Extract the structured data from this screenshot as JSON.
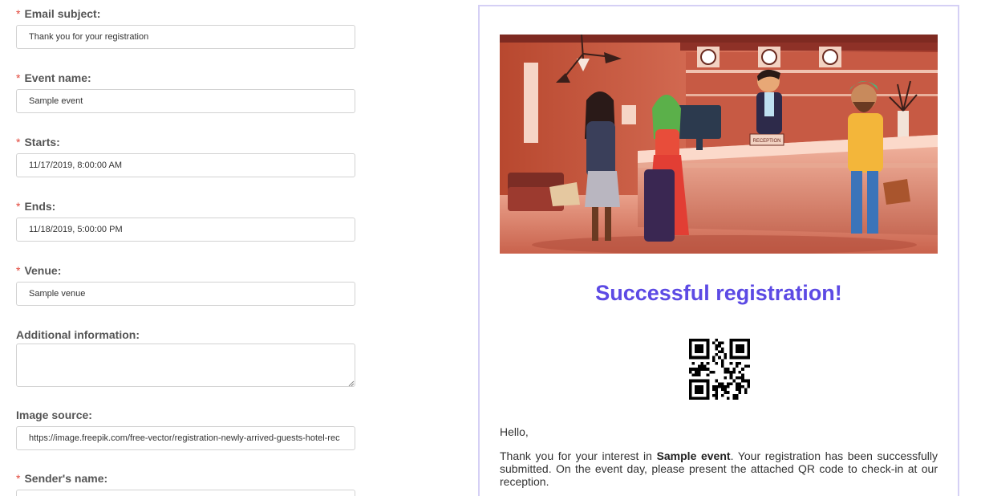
{
  "form": {
    "required_marker": "*",
    "email_subject": {
      "label": "Email subject:",
      "value": "Thank you for your registration"
    },
    "event_name": {
      "label": "Event name:",
      "value": "Sample event"
    },
    "starts": {
      "label": "Starts:",
      "value": "11/17/2019, 8:00:00 AM"
    },
    "ends": {
      "label": "Ends:",
      "value": "11/18/2019, 5:00:00 PM"
    },
    "venue": {
      "label": "Venue:",
      "value": "Sample venue"
    },
    "additional_info": {
      "label": "Additional information:",
      "value": ""
    },
    "image_source": {
      "label": "Image source:",
      "value": "https://image.freepik.com/free-vector/registration-newly-arrived-guests-hotel-rec"
    },
    "sender_name": {
      "label": "Sender's name:",
      "value": ""
    }
  },
  "preview": {
    "hero_sign": "RECEPTION",
    "headline": "Successful registration!",
    "greeting": "Hello,",
    "body_prefix": "Thank you for your interest in ",
    "event_name": "Sample event",
    "body_suffix": ". Your registration has been successfully submitted. On the event day, please present the attached QR code to check-in at our reception.",
    "accent_color": "#5c4ae4",
    "border_color": "#d5d0f5"
  }
}
